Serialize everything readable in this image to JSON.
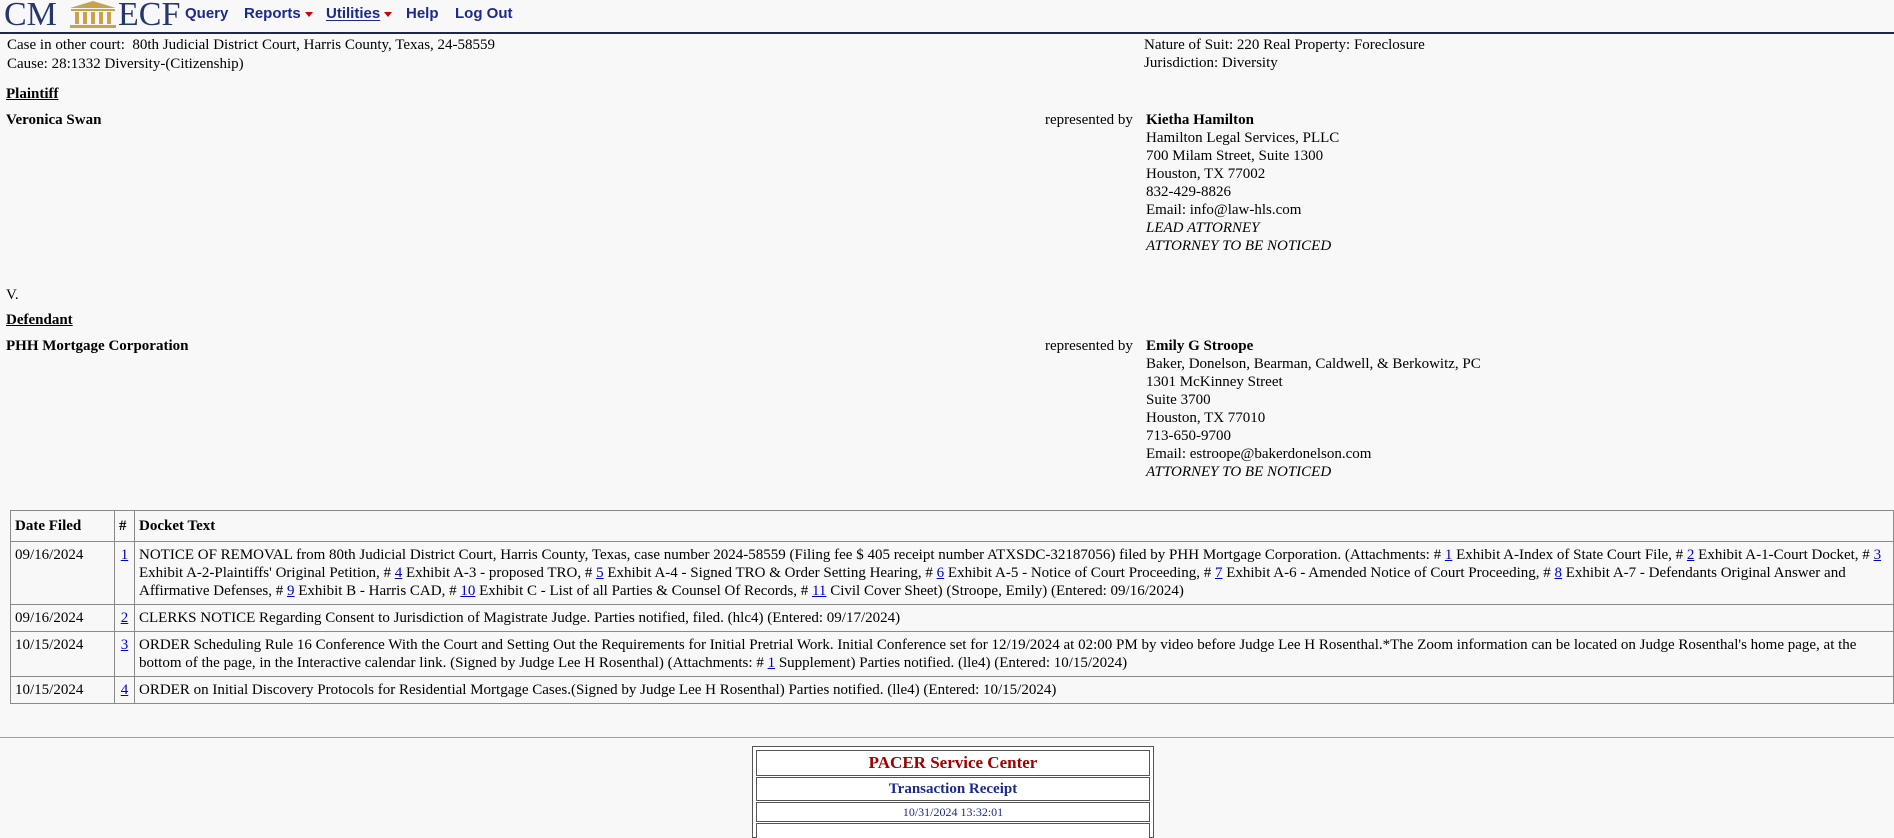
{
  "menu": {
    "logo_left": "CM",
    "logo_right": "ECF",
    "items": [
      "Query",
      "Reports",
      "Utilities",
      "Help",
      "Log Out"
    ]
  },
  "case": {
    "other_court_label": "Case in other court:",
    "other_court_value": "80th Judicial District Court, Harris County, Texas, 24-58559",
    "cause": "Cause: 28:1332 Diversity-(Citizenship)",
    "nature_of_suit": "Nature of Suit: 220 Real Property: Foreclosure",
    "jurisdiction": "Jurisdiction: Diversity"
  },
  "plaintiff": {
    "heading": "Plaintiff",
    "name": "Veronica Swan",
    "represented_by": "represented by",
    "attorney": {
      "name": "Kietha Hamilton",
      "lines": [
        "Hamilton Legal Services, PLLC",
        "700 Milam Street, Suite 1300",
        "Houston, TX 77002",
        "832-429-8826",
        "Email: info@law-hls.com"
      ],
      "notes": [
        "LEAD ATTORNEY",
        "ATTORNEY TO BE NOTICED"
      ]
    }
  },
  "versus": "V.",
  "defendant": {
    "heading": "Defendant",
    "name": "PHH Mortgage Corporation",
    "represented_by": "represented by",
    "attorney": {
      "name": "Emily G Stroope",
      "lines": [
        "Baker, Donelson, Bearman, Caldwell, & Berkowitz, PC",
        "1301 McKinney Street",
        "Suite 3700",
        "Houston, TX 77010",
        "713-650-9700",
        "Email: estroope@bakerdonelson.com"
      ],
      "notes": [
        "ATTORNEY TO BE NOTICED"
      ]
    }
  },
  "docket": {
    "headers": [
      "Date Filed",
      "#",
      "Docket Text"
    ],
    "rows": [
      {
        "date": "09/16/2024",
        "num": "1",
        "parts": [
          {
            "t": "NOTICE OF REMOVAL from 80th Judicial District Court, Harris County, Texas, case number 2024-58559 (Filing fee $ 405 receipt number ATXSDC-32187056) filed by PHH Mortgage Corporation. (Attachments: # "
          },
          {
            "l": "1"
          },
          {
            "t": " Exhibit A-Index of State Court File, # "
          },
          {
            "l": "2"
          },
          {
            "t": " Exhibit A-1-Court Docket, # "
          },
          {
            "l": "3"
          },
          {
            "t": " Exhibit A-2-Plaintiffs' Original Petition, # "
          },
          {
            "l": "4"
          },
          {
            "t": " Exhibit A-3 - proposed TRO, # "
          },
          {
            "l": "5"
          },
          {
            "t": " Exhibit A-4 - Signed TRO & Order Setting Hearing, # "
          },
          {
            "l": "6"
          },
          {
            "t": " Exhibit A-5 - Notice of Court Proceeding, # "
          },
          {
            "l": "7"
          },
          {
            "t": " Exhibit A-6 - Amended Notice of Court Proceeding, # "
          },
          {
            "l": "8"
          },
          {
            "t": " Exhibit A-7 - Defendants Original Answer and Affirmative Defenses, # "
          },
          {
            "l": "9"
          },
          {
            "t": " Exhibit B - Harris CAD, # "
          },
          {
            "l": "10"
          },
          {
            "t": " Exhibit C - List of all Parties & Counsel Of Records, # "
          },
          {
            "l": "11"
          },
          {
            "t": " Civil Cover Sheet) (Stroope, Emily) (Entered: 09/16/2024)"
          }
        ]
      },
      {
        "date": "09/16/2024",
        "num": "2",
        "parts": [
          {
            "t": "CLERKS NOTICE Regarding Consent to Jurisdiction of Magistrate Judge. Parties notified, filed. (hlc4) (Entered: 09/17/2024)"
          }
        ]
      },
      {
        "date": "10/15/2024",
        "num": "3",
        "parts": [
          {
            "t": "ORDER Scheduling Rule 16 Conference With the Court and Setting Out the Requirements for Initial Pretrial Work. Initial Conference set for 12/19/2024 at 02:00 PM by video before Judge Lee H Rosenthal.*The Zoom information can be located on Judge Rosenthal's home page, at the bottom of the page, in the Interactive calendar link. (Signed by Judge Lee H Rosenthal) (Attachments: # "
          },
          {
            "l": "1"
          },
          {
            "t": " Supplement) Parties notified. (lle4) (Entered: 10/15/2024)"
          }
        ]
      },
      {
        "date": "10/15/2024",
        "num": "4",
        "parts": [
          {
            "t": "ORDER on Initial Discovery Protocols for Residential Mortgage Cases.(Signed by Judge Lee H Rosenthal) Parties notified. (lle4) (Entered: 10/15/2024)"
          }
        ]
      }
    ]
  },
  "receipt": {
    "title": "PACER Service Center",
    "subtitle": "Transaction Receipt",
    "timestamp": "10/31/2024 13:32:01"
  },
  "colors": {
    "link": "#0000cc",
    "menu": "#1c2a8c",
    "logo": "#26376d",
    "logo_column": "#c8a34a",
    "receipt_title": "#a00000"
  }
}
